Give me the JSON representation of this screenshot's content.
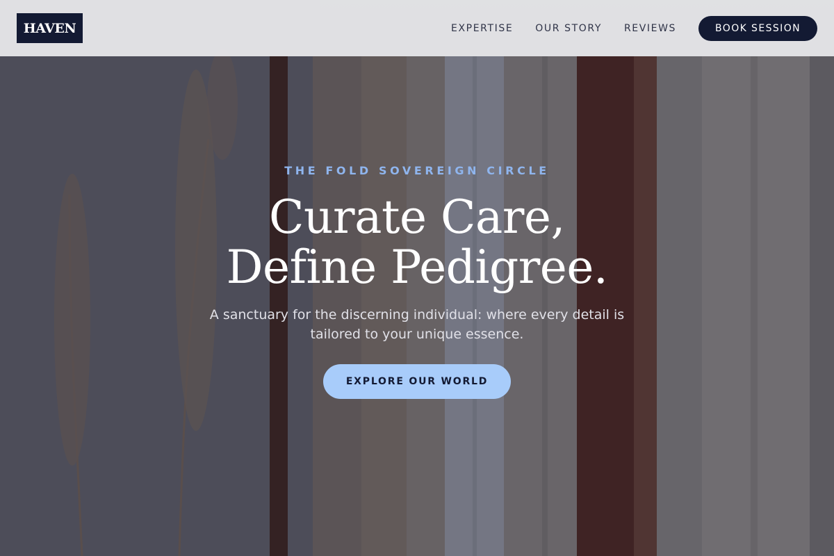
{
  "brand": {
    "logo_text": "HAVEN"
  },
  "nav": {
    "links": [
      "EXPERTISE",
      "OUR STORY",
      "REVIEWS"
    ],
    "cta_label": "BOOK SESSION"
  },
  "hero": {
    "eyebrow": "THE FOLD SOVEREIGN CIRCLE",
    "headline_line1": "Curate Care,",
    "headline_line2": "Define Pedigree.",
    "subtext": "A sanctuary for the discerning individual: where every detail is tailored to your unique essence.",
    "cta_label": "EXPLORE OUR WORLD"
  },
  "colors": {
    "navy": "#131a33",
    "accent_blue": "#a8ccfa",
    "eyebrow_blue": "#8fb5ee",
    "header_bg": "#ececee"
  }
}
